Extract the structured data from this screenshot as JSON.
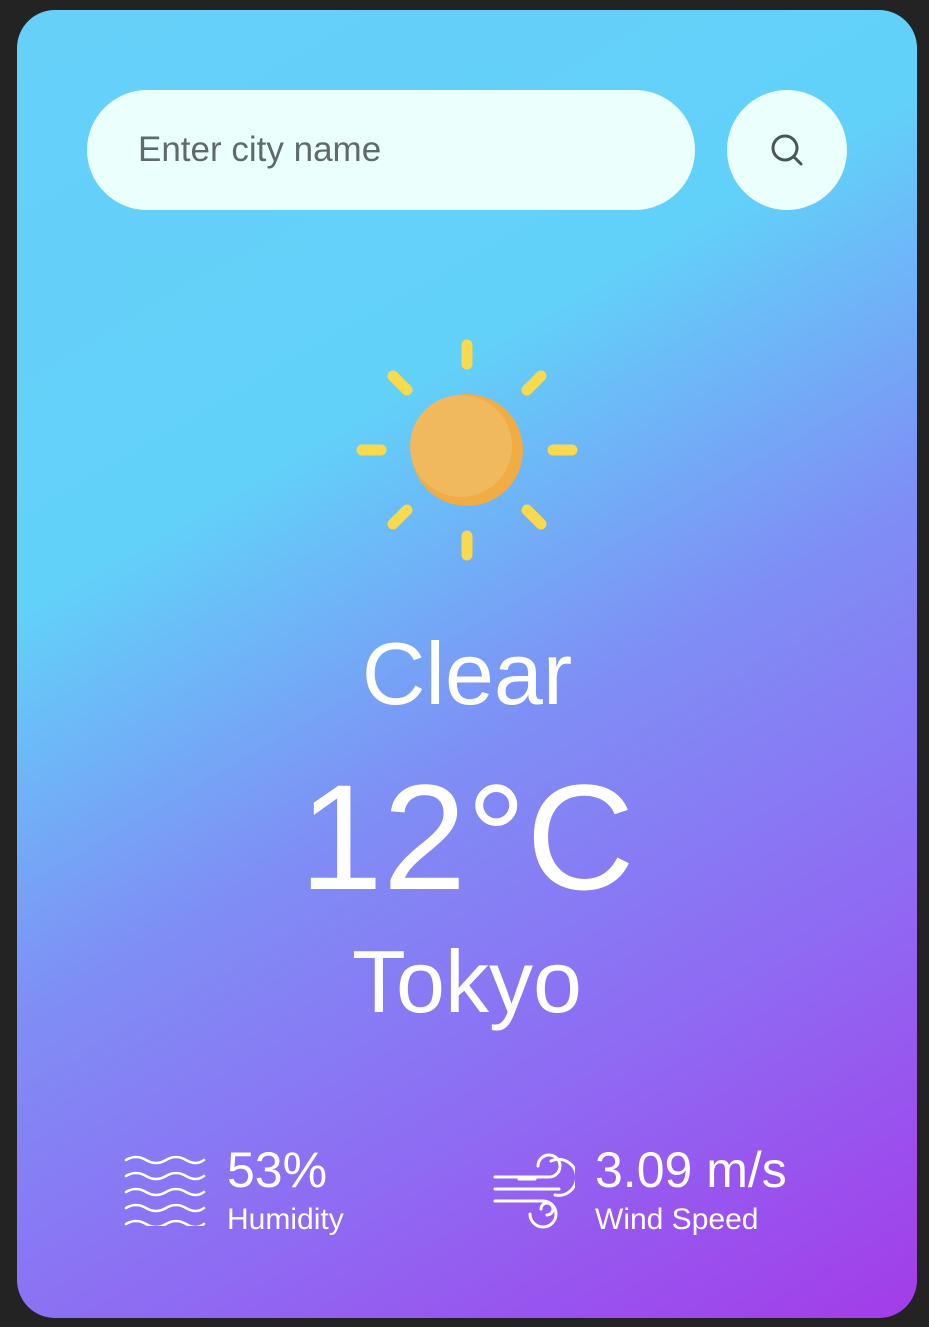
{
  "search": {
    "placeholder": "Enter city name",
    "button_icon": "search-icon"
  },
  "weather": {
    "icon": "sun-icon",
    "condition": "Clear",
    "temperature": "12°C",
    "city": "Tokyo"
  },
  "details": {
    "humidity": {
      "icon": "humidity-waves-icon",
      "value": "53%",
      "label": "Humidity"
    },
    "wind": {
      "icon": "wind-icon",
      "value": "3.09 m/s",
      "label": "Wind Speed"
    }
  },
  "colors": {
    "gradient_start": "#62d1f9",
    "gradient_end": "#a33ce9",
    "input_background": "#ebfffc",
    "sun_core": "#f2b45a",
    "sun_rays": "#f9d94d"
  }
}
